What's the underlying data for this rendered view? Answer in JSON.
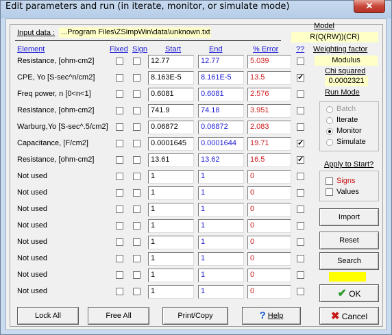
{
  "window": {
    "title": "Edit parameters and run (in iterate, monitor, or simulate mode)",
    "close": "✕"
  },
  "input_data": {
    "label": "Input data :",
    "path": "...Program Files\\ZSimpWin\\data\\unknown.txt"
  },
  "headers": {
    "element": "Element",
    "fixed": "Fixed",
    "sign": "Sign",
    "start": "Start",
    "end": "End",
    "error": "% Error",
    "qq": "??"
  },
  "rows": [
    {
      "element": "Resistance,   [ohm-cm2]",
      "fixed": false,
      "sign": false,
      "start": "12.77",
      "end": "12.77",
      "error": "5.039",
      "qq": false
    },
    {
      "element": "CPE, Yo  [S-sec^n/cm2]",
      "fixed": false,
      "sign": false,
      "start": "8.163E-5",
      "end": "8.161E-5",
      "error": "13.5",
      "qq": true
    },
    {
      "element": "Freq power, n   [0<n<1]",
      "fixed": false,
      "sign": false,
      "start": "0.6081",
      "end": "0.6081",
      "error": "2.576",
      "qq": false
    },
    {
      "element": "Resistance,   [ohm-cm2]",
      "fixed": false,
      "sign": false,
      "start": "741.9",
      "end": "74.18",
      "error": "3.951",
      "qq": false
    },
    {
      "element": "Warburg,Yo [S-sec^.5/cm2]",
      "fixed": false,
      "sign": false,
      "start": "0.06872",
      "end": "0.06872",
      "error": "2.083",
      "qq": false
    },
    {
      "element": "Capacitance,     [F/cm2]",
      "fixed": false,
      "sign": false,
      "start": "0.0001645",
      "end": "0.0001644",
      "error": "19.71",
      "qq": true
    },
    {
      "element": "Resistance,   [ohm-cm2]",
      "fixed": false,
      "sign": false,
      "start": "13.61",
      "end": "13.62",
      "error": "16.5",
      "qq": true
    },
    {
      "element": "Not used",
      "fixed": false,
      "sign": false,
      "start": "1",
      "end": "1",
      "error": "0",
      "qq": false
    },
    {
      "element": "Not used",
      "fixed": false,
      "sign": false,
      "start": "1",
      "end": "1",
      "error": "0",
      "qq": false
    },
    {
      "element": "Not used",
      "fixed": false,
      "sign": false,
      "start": "1",
      "end": "1",
      "error": "0",
      "qq": false
    },
    {
      "element": "Not used",
      "fixed": false,
      "sign": false,
      "start": "1",
      "end": "1",
      "error": "0",
      "qq": false
    },
    {
      "element": "Not used",
      "fixed": false,
      "sign": false,
      "start": "1",
      "end": "1",
      "error": "0",
      "qq": false
    },
    {
      "element": "Not used",
      "fixed": false,
      "sign": false,
      "start": "1",
      "end": "1",
      "error": "0",
      "qq": false
    },
    {
      "element": "Not used",
      "fixed": false,
      "sign": false,
      "start": "1",
      "end": "1",
      "error": "0",
      "qq": false
    },
    {
      "element": "Not used",
      "fixed": false,
      "sign": false,
      "start": "1",
      "end": "1",
      "error": "0",
      "qq": false
    }
  ],
  "side": {
    "model_label": "Model",
    "model_value": "R(Q(RW))(CR)",
    "weighting_label": "Weighting  factor",
    "weighting_value": "Modulus",
    "chi_label": "Chi squared",
    "chi_value": "0.0002321",
    "run_mode_label": "Run Mode",
    "run_modes": [
      {
        "label": "Batch",
        "selected": false,
        "enabled": false
      },
      {
        "label": "Iterate",
        "selected": false,
        "enabled": true
      },
      {
        "label": "Monitor",
        "selected": true,
        "enabled": true
      },
      {
        "label": "Simulate",
        "selected": false,
        "enabled": true
      }
    ],
    "apply_label": "Apply to Start?",
    "apply_signs": "Signs",
    "apply_values": "Values",
    "import": "Import",
    "reset": "Reset",
    "search": "Search",
    "ok": "OK",
    "cancel": "Cancel"
  },
  "bottom": {
    "lock_all": "Lock All",
    "free_all": "Free All",
    "print_copy": "Print/Copy",
    "help": "Help"
  },
  "colors": {
    "link_blue": "#1a1ad4",
    "error_red": "#cc1a1a",
    "status_yellow": "#ffff00",
    "ok_green": "#2a9a2a",
    "cancel_red": "#c81818"
  }
}
